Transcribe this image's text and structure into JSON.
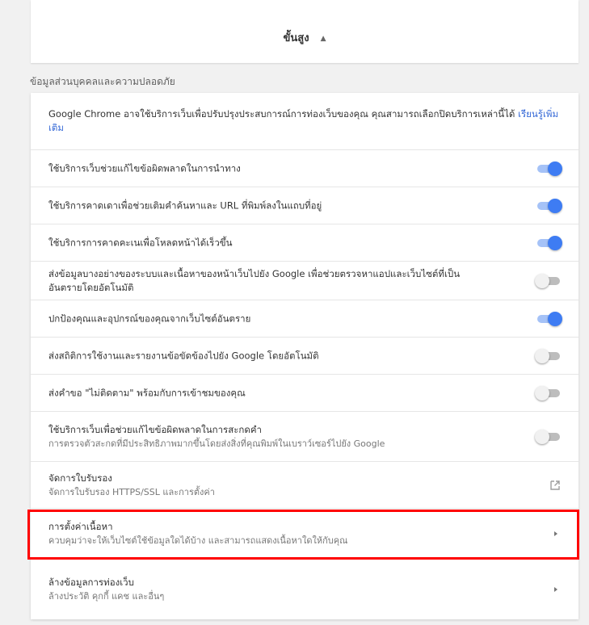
{
  "advanced": {
    "label": "ขั้นสูง",
    "icon": "chevron-up-icon"
  },
  "privacy_section": {
    "title": "ข้อมูลส่วนบุคคลและความปลอดภัย",
    "intro": {
      "text": "Google Chrome อาจใช้บริการเว็บเพื่อปรับปรุงประสบการณ์การท่องเว็บของคุณ คุณสามารถเลือกปิดบริการเหล่านี้ได้",
      "link": "เรียนรู้เพิ่มเติม"
    },
    "toggles": [
      {
        "label": "ใช้บริการเว็บช่วยแก้ไขข้อผิดพลาดในการนำทาง",
        "on": true
      },
      {
        "label": "ใช้บริการคาดเดาเพื่อช่วยเติมคำค้นหาและ URL ที่พิมพ์ลงในแถบที่อยู่",
        "on": true
      },
      {
        "label": "ใช้บริการการคาดคะเนเพื่อโหลดหน้าได้เร็วขึ้น",
        "on": true
      },
      {
        "label": "ส่งข้อมูลบางอย่างของระบบและเนื้อหาของหน้าเว็บไปยัง Google เพื่อช่วยตรวจหาแอปและเว็บไซต์ที่เป็นอันตรายโดยอัตโนมัติ",
        "on": false
      },
      {
        "label": "ปกป้องคุณและอุปกรณ์ของคุณจากเว็บไซต์อันตราย",
        "on": true
      },
      {
        "label": "ส่งสถิติการใช้งานและรายงานข้อขัดข้องไปยัง Google โดยอัตโนมัติ",
        "on": false
      },
      {
        "label": "ส่งคำขอ \"ไม่ติดตาม\" พร้อมกับการเข้าชมของคุณ",
        "on": false
      },
      {
        "label": "ใช้บริการเว็บเพื่อช่วยแก้ไขข้อผิดพลาดในการสะกดคำ",
        "sub": "การตรวจตัวสะกดที่มีประสิทธิภาพมากขึ้นโดยส่งสิ่งที่คุณพิมพ์ในเบราว์เซอร์ไปยัง Google",
        "on": false
      }
    ],
    "certificates": {
      "label": "จัดการใบรับรอง",
      "sub": "จัดการใบรับรอง HTTPS/SSL และการตั้งค่า",
      "icon": "external-link-icon"
    },
    "content_settings": {
      "label": "การตั้งค่าเนื้อหา",
      "sub": "ควบคุมว่าจะให้เว็บไซต์ใช้ข้อมูลใดได้บ้าง และสามารถแสดงเนื้อหาใดให้กับคุณ",
      "icon": "arrow-right-icon"
    },
    "clear_data": {
      "label": "ล้างข้อมูลการท่องเว็บ",
      "sub": "ล้างประวัติ คุกกี้ แคช และอื่นๆ",
      "icon": "arrow-right-icon"
    }
  },
  "colors": {
    "highlight": "#ff0000",
    "toggle_on": "#3e7cf3",
    "link": "#3367d6"
  }
}
